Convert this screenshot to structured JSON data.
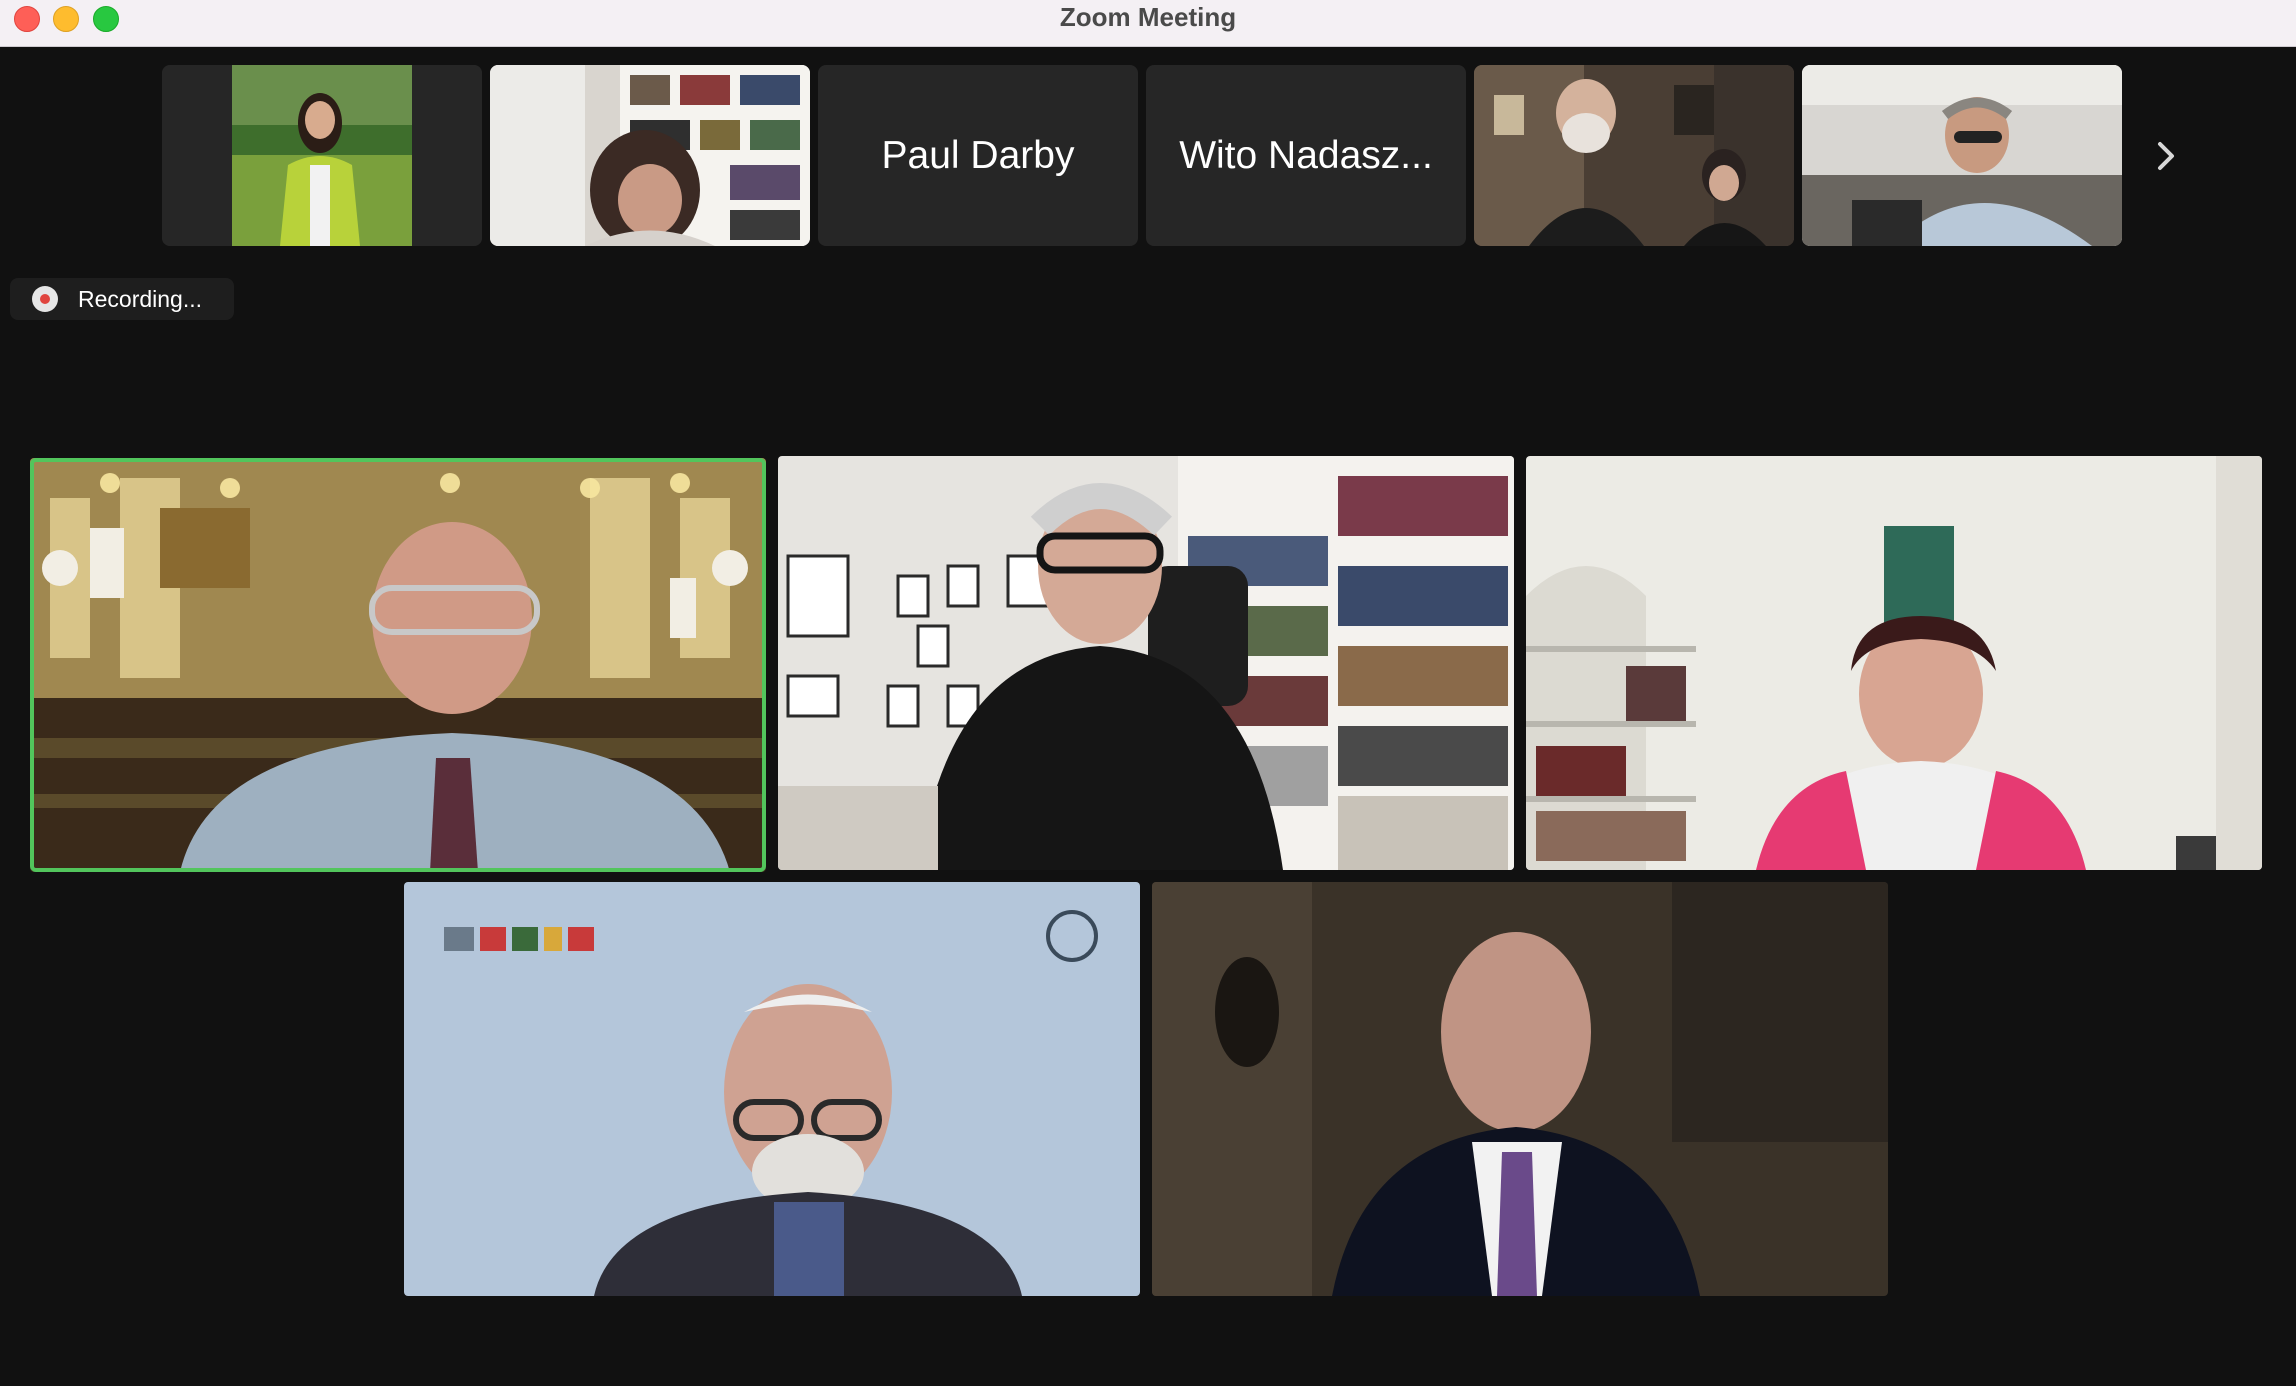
{
  "window": {
    "title": "Zoom Meeting",
    "controls": [
      "close",
      "minimize",
      "zoom"
    ]
  },
  "participant_strip": {
    "tiles": [
      {
        "type": "video",
        "icon": "woman-in-green-jacket-video"
      },
      {
        "type": "video",
        "icon": "woman-with-bookshelf-video"
      },
      {
        "type": "name",
        "name": "Paul Darby"
      },
      {
        "type": "name",
        "name": "Wito Nadasz..."
      },
      {
        "type": "video",
        "icon": "couple-video"
      },
      {
        "type": "video",
        "icon": "man-on-sofa-video"
      }
    ],
    "next_icon": "chevron-right-icon"
  },
  "recording": {
    "label": "Recording...",
    "icon": "recording-icon"
  },
  "gallery": {
    "active_speaker_color": "#52c55c",
    "tiles": [
      {
        "icon": "speaker-synagogue-video",
        "active": true
      },
      {
        "icon": "man-with-glasses-bookshelf-video",
        "active": false
      },
      {
        "icon": "woman-living-room-video",
        "active": false
      },
      {
        "icon": "man-kippah-logo-background-video",
        "active": false
      },
      {
        "icon": "man-suit-dark-room-video",
        "active": false
      }
    ]
  }
}
